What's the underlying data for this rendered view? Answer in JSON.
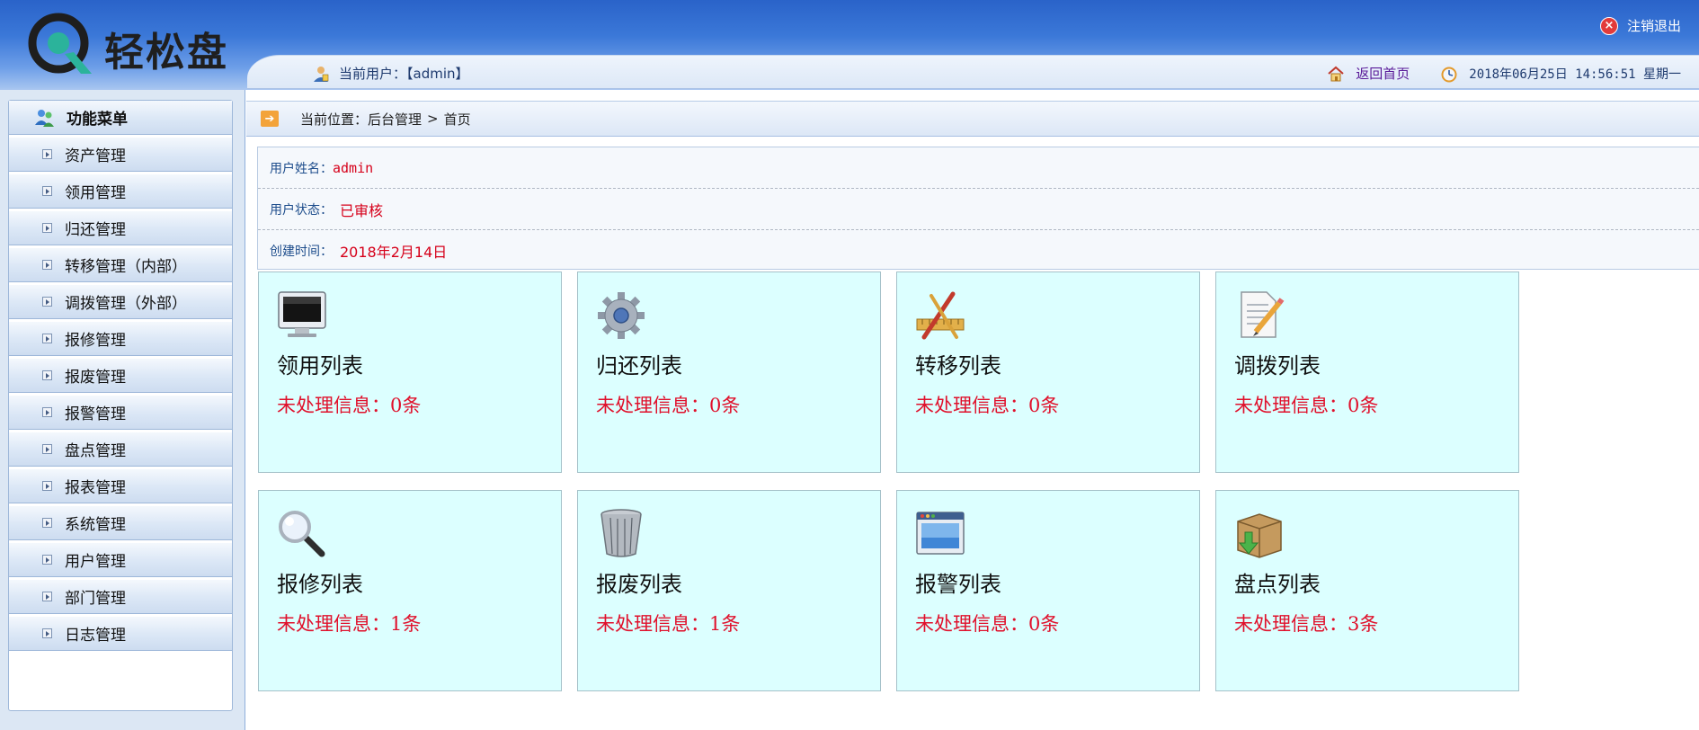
{
  "header": {
    "brand": "轻松盘",
    "logout_label": "注销退出",
    "current_user_label": "当前用户：【admin】",
    "home_label": "返回首页",
    "datetime": "2018年06月25日 14:56:51 星期一"
  },
  "sidebar": {
    "title": "功能菜单",
    "items": [
      {
        "label": "资产管理"
      },
      {
        "label": "领用管理"
      },
      {
        "label": "归还管理"
      },
      {
        "label": "转移管理（内部）"
      },
      {
        "label": "调拨管理（外部）"
      },
      {
        "label": "报修管理"
      },
      {
        "label": "报废管理"
      },
      {
        "label": "报警管理"
      },
      {
        "label": "盘点管理"
      },
      {
        "label": "报表管理"
      },
      {
        "label": "系统管理"
      },
      {
        "label": "用户管理"
      },
      {
        "label": "部门管理"
      },
      {
        "label": "日志管理"
      }
    ]
  },
  "breadcrumb": {
    "prefix": "当前位置：",
    "parent": "后台管理",
    "separator": ">",
    "current": "首页"
  },
  "user_info": {
    "name_label": "用户姓名：",
    "name_value": "admin",
    "status_label": "用户状态：",
    "status_value": "已审核",
    "created_label": "创建时间：",
    "created_value": "2018年2月14日"
  },
  "cards": [
    {
      "title": "领用列表",
      "count_text": "未处理信息：0条",
      "icon": "monitor-icon"
    },
    {
      "title": "归还列表",
      "count_text": "未处理信息：0条",
      "icon": "gear-icon"
    },
    {
      "title": "转移列表",
      "count_text": "未处理信息：0条",
      "icon": "tools-icon"
    },
    {
      "title": "调拨列表",
      "count_text": "未处理信息：0条",
      "icon": "document-pencil-icon"
    },
    {
      "title": "报修列表",
      "count_text": "未处理信息：1条",
      "icon": "magnifier-icon"
    },
    {
      "title": "报废列表",
      "count_text": "未处理信息：1条",
      "icon": "trash-icon"
    },
    {
      "title": "报警列表",
      "count_text": "未处理信息：0条",
      "icon": "window-icon"
    },
    {
      "title": "盘点列表",
      "count_text": "未处理信息：3条",
      "icon": "box-icon"
    }
  ],
  "colors": {
    "header_blue": "#3b78d8",
    "card_bg": "#dcffff",
    "alert_red": "#e0102b",
    "link_purple": "#5a1b99"
  }
}
